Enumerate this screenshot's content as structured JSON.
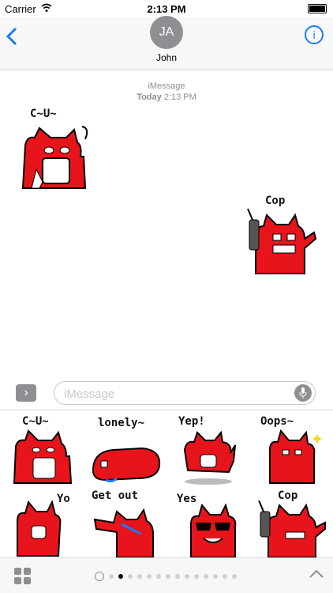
{
  "status_bar": {
    "carrier": "Carrier",
    "time": "2:13 PM"
  },
  "nav": {
    "avatar_initials": "JA",
    "contact_name": "John"
  },
  "conversation": {
    "service_label": "iMessage",
    "day_label": "Today",
    "time_label": "2:13 PM",
    "messages": [
      {
        "side": "incoming",
        "caption": "C~U~"
      },
      {
        "side": "outgoing",
        "caption": "Cop"
      }
    ]
  },
  "input": {
    "placeholder": "iMessage"
  },
  "sticker_drawer": {
    "stickers": [
      {
        "caption": "C~U~"
      },
      {
        "caption": "lonely~"
      },
      {
        "caption": "Yep!"
      },
      {
        "caption": "Oops~"
      },
      {
        "caption": "Yo"
      },
      {
        "caption": "Get out"
      },
      {
        "caption": "Yes"
      },
      {
        "caption": "Cop"
      }
    ]
  },
  "colors": {
    "accent": "#1a7cf5",
    "sticker_red": "#e8141b"
  }
}
